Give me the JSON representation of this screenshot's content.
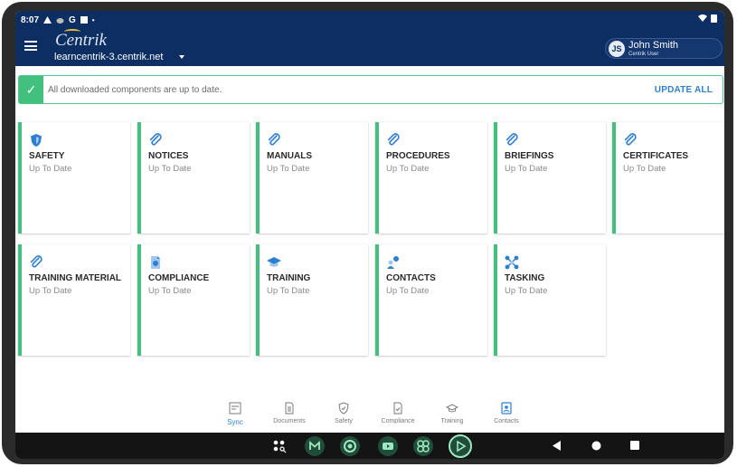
{
  "status_bar": {
    "time": "8:07",
    "indicator": "G"
  },
  "header": {
    "logo_text": "Centrik",
    "site": "learncentrik-3.centrik.net",
    "user": {
      "initials": "JS",
      "name": "John Smith",
      "role": "Centrik User"
    }
  },
  "banner": {
    "message": "All downloaded components are up to date.",
    "action_label": "UPDATE ALL"
  },
  "tiles": [
    {
      "title": "SAFETY",
      "status": "Up To Date",
      "icon": "shield-icon"
    },
    {
      "title": "NOTICES",
      "status": "Up To Date",
      "icon": "paperclip-icon"
    },
    {
      "title": "MANUALS",
      "status": "Up To Date",
      "icon": "paperclip-icon"
    },
    {
      "title": "PROCEDURES",
      "status": "Up To Date",
      "icon": "paperclip-icon"
    },
    {
      "title": "BRIEFINGS",
      "status": "Up To Date",
      "icon": "paperclip-icon"
    },
    {
      "title": "CERTIFICATES",
      "status": "Up To Date",
      "icon": "paperclip-icon"
    },
    {
      "title": "TRAINING MATERIAL",
      "status": "Up To Date",
      "icon": "paperclip-icon"
    },
    {
      "title": "COMPLIANCE",
      "status": "Up To Date",
      "icon": "document-check-icon"
    },
    {
      "title": "TRAINING",
      "status": "Up To Date",
      "icon": "graduation-cap-icon"
    },
    {
      "title": "CONTACTS",
      "status": "Up To Date",
      "icon": "contacts-icon"
    },
    {
      "title": "TASKING",
      "status": "Up To Date",
      "icon": "network-icon"
    }
  ],
  "bottom_nav": [
    {
      "label": "Sync",
      "icon": "sync-icon",
      "active": true
    },
    {
      "label": "Documents",
      "icon": "documents-icon",
      "active": false
    },
    {
      "label": "Safety",
      "icon": "shield-outline-icon",
      "active": false
    },
    {
      "label": "Compliance",
      "icon": "compliance-icon",
      "active": false
    },
    {
      "label": "Training",
      "icon": "graduation-cap-outline-icon",
      "active": false
    },
    {
      "label": "Contacts",
      "icon": "contacts-book-icon",
      "active": false
    }
  ],
  "system_bar": {
    "apps": [
      "app-drawer-icon",
      "gmail-icon",
      "chrome-icon",
      "youtube-icon",
      "photos-icon",
      "play-icon"
    ],
    "nav": [
      "back-icon",
      "home-icon",
      "recents-icon"
    ]
  },
  "colors": {
    "header_bg": "#0c2e63",
    "accent_green": "#43c07e",
    "link_blue": "#2f7fd0"
  }
}
